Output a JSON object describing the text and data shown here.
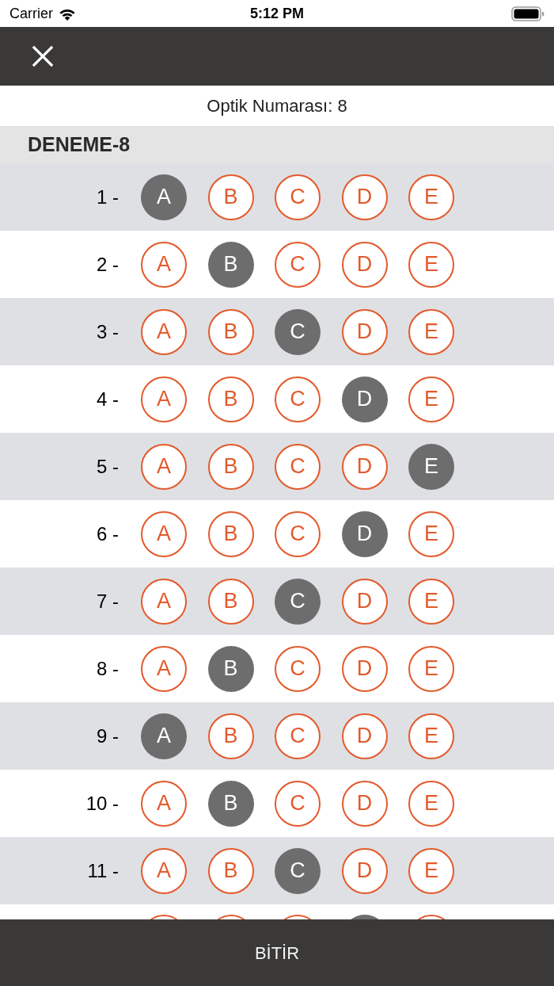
{
  "status_bar": {
    "carrier": "Carrier",
    "time": "5:12 PM"
  },
  "optic_number": "Optik Numarası: 8",
  "section": {
    "title": "DENEME-8"
  },
  "rows": [
    {
      "number": "1 -",
      "options": [
        {
          "label": "A",
          "selected": true
        },
        {
          "label": "B",
          "selected": false
        },
        {
          "label": "C",
          "selected": false
        },
        {
          "label": "D",
          "selected": false
        },
        {
          "label": "E",
          "selected": false
        }
      ]
    },
    {
      "number": "2 -",
      "options": [
        {
          "label": "A",
          "selected": false
        },
        {
          "label": "B",
          "selected": true
        },
        {
          "label": "C",
          "selected": false
        },
        {
          "label": "D",
          "selected": false
        },
        {
          "label": "E",
          "selected": false
        }
      ]
    },
    {
      "number": "3 -",
      "options": [
        {
          "label": "A",
          "selected": false
        },
        {
          "label": "B",
          "selected": false
        },
        {
          "label": "C",
          "selected": true
        },
        {
          "label": "D",
          "selected": false
        },
        {
          "label": "E",
          "selected": false
        }
      ]
    },
    {
      "number": "4 -",
      "options": [
        {
          "label": "A",
          "selected": false
        },
        {
          "label": "B",
          "selected": false
        },
        {
          "label": "C",
          "selected": false
        },
        {
          "label": "D",
          "selected": true
        },
        {
          "label": "E",
          "selected": false
        }
      ]
    },
    {
      "number": "5 -",
      "options": [
        {
          "label": "A",
          "selected": false
        },
        {
          "label": "B",
          "selected": false
        },
        {
          "label": "C",
          "selected": false
        },
        {
          "label": "D",
          "selected": false
        },
        {
          "label": "E",
          "selected": true
        }
      ]
    },
    {
      "number": "6 -",
      "options": [
        {
          "label": "A",
          "selected": false
        },
        {
          "label": "B",
          "selected": false
        },
        {
          "label": "C",
          "selected": false
        },
        {
          "label": "D",
          "selected": true
        },
        {
          "label": "E",
          "selected": false
        }
      ]
    },
    {
      "number": "7 -",
      "options": [
        {
          "label": "A",
          "selected": false
        },
        {
          "label": "B",
          "selected": false
        },
        {
          "label": "C",
          "selected": true
        },
        {
          "label": "D",
          "selected": false
        },
        {
          "label": "E",
          "selected": false
        }
      ]
    },
    {
      "number": "8 -",
      "options": [
        {
          "label": "A",
          "selected": false
        },
        {
          "label": "B",
          "selected": true
        },
        {
          "label": "C",
          "selected": false
        },
        {
          "label": "D",
          "selected": false
        },
        {
          "label": "E",
          "selected": false
        }
      ]
    },
    {
      "number": "9 -",
      "options": [
        {
          "label": "A",
          "selected": true
        },
        {
          "label": "B",
          "selected": false
        },
        {
          "label": "C",
          "selected": false
        },
        {
          "label": "D",
          "selected": false
        },
        {
          "label": "E",
          "selected": false
        }
      ]
    },
    {
      "number": "10 -",
      "options": [
        {
          "label": "A",
          "selected": false
        },
        {
          "label": "B",
          "selected": true
        },
        {
          "label": "C",
          "selected": false
        },
        {
          "label": "D",
          "selected": false
        },
        {
          "label": "E",
          "selected": false
        }
      ]
    },
    {
      "number": "11 -",
      "options": [
        {
          "label": "A",
          "selected": false
        },
        {
          "label": "B",
          "selected": false
        },
        {
          "label": "C",
          "selected": true
        },
        {
          "label": "D",
          "selected": false
        },
        {
          "label": "E",
          "selected": false
        }
      ]
    }
  ],
  "partial_row": {
    "options": [
      {
        "selected": false
      },
      {
        "selected": false
      },
      {
        "selected": false
      },
      {
        "selected": true
      },
      {
        "selected": false
      }
    ]
  },
  "footer_button": "BİTİR"
}
